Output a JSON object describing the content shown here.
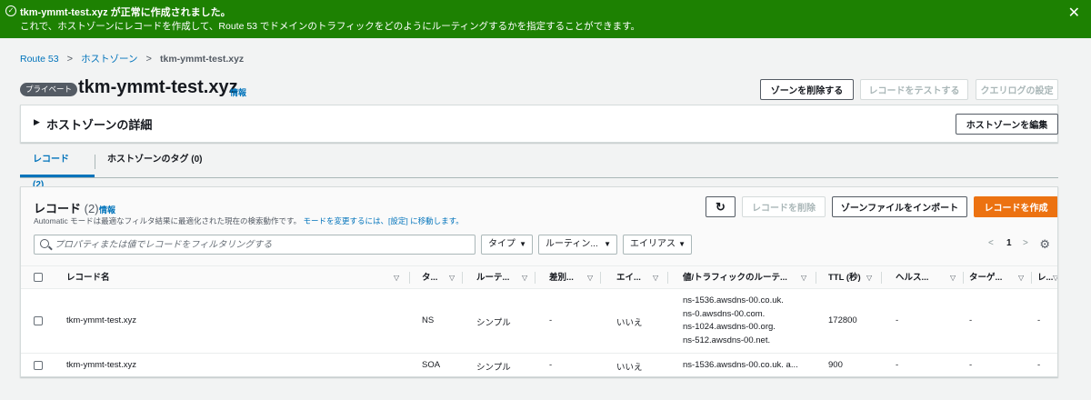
{
  "flash": {
    "title": "tkm-ymmt-test.xyz が正常に作成されました。",
    "message": "これで、ホストゾーンにレコードを作成して、Route 53 でドメインのトラフィックをどのようにルーティングするかを指定することができます。"
  },
  "breadcrumb": {
    "root": "Route 53",
    "parent": "ホストゾーン",
    "current": "tkm-ymmt-test.xyz"
  },
  "header": {
    "badge": "プライベート",
    "title": "tkm-ymmt-test.xyz",
    "info": "情報",
    "delete_zone": "ゾーンを削除する",
    "test_record": "レコードをテストする",
    "query_log": "クエリログの設定"
  },
  "details": {
    "title": "ホストゾーンの詳細",
    "edit": "ホストゾーンを編集"
  },
  "tabs": [
    {
      "label": "レコード (2)"
    },
    {
      "label": "ホストゾーンのタグ (0)"
    }
  ],
  "records": {
    "title": "レコード",
    "count": "(2)",
    "info": "情報",
    "desc_prefix": "Automatic モードは最適なフィルタ結果に最適化された現在の検索動作です。",
    "desc_link": "モードを変更するには、[設定] に移動します。",
    "delete": "レコードを削除",
    "import": "ゾーンファイルをインポート",
    "create": "レコードを作成",
    "search_placeholder": "プロパティまたは値でレコードをフィルタリングする",
    "filters": [
      "タイプ",
      "ルーティン...",
      "エイリアス"
    ],
    "page": "1",
    "columns": [
      "レコード名",
      "タ...",
      "ルーテ...",
      "差別...",
      "エイ...",
      "値/トラフィックのルーテ...",
      "TTL (秒)",
      "ヘルス...",
      "ターゲ...",
      "レ..."
    ],
    "rows": [
      {
        "name": "tkm-ymmt-test.xyz",
        "type": "NS",
        "routing": "シンプル",
        "diff": "-",
        "alias": "いいえ",
        "values": [
          "ns-1536.awsdns-00.co.uk.",
          "ns-0.awsdns-00.com.",
          "ns-1024.awsdns-00.org.",
          "ns-512.awsdns-00.net."
        ],
        "ttl": "172800",
        "health": "-",
        "target": "-",
        "last": "-"
      },
      {
        "name": "tkm-ymmt-test.xyz",
        "type": "SOA",
        "routing": "シンプル",
        "diff": "-",
        "alias": "いいえ",
        "values": [
          "ns-1536.awsdns-00.co.uk. a..."
        ],
        "ttl": "900",
        "health": "-",
        "target": "-",
        "last": "-"
      }
    ]
  },
  "colors": {
    "success": "#1d8102",
    "link": "#0073bb",
    "primary": "#ec7211"
  },
  "icons": [
    "success-check-icon",
    "close-icon",
    "chevron-right-icon",
    "caret-right-icon",
    "refresh-icon",
    "search-icon",
    "caret-down-icon",
    "gear-icon"
  ]
}
